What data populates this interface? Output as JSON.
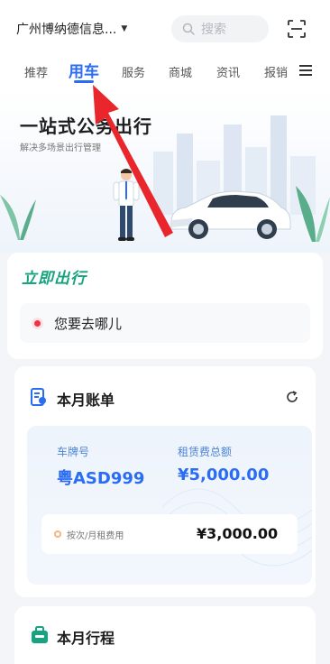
{
  "header": {
    "company_name": "广州博纳德信息...",
    "search_placeholder": "搜索"
  },
  "tabs": [
    {
      "label": "推荐",
      "active": false
    },
    {
      "label": "用车",
      "active": true
    },
    {
      "label": "服务",
      "active": false
    },
    {
      "label": "商城",
      "active": false
    },
    {
      "label": "资讯",
      "active": false
    },
    {
      "label": "报销",
      "active": false
    }
  ],
  "hero": {
    "title": "一站式公务出行",
    "subtitle": "解决多场景出行管理"
  },
  "go": {
    "title": "立即出行",
    "destination_placeholder": "您要去哪儿"
  },
  "bill": {
    "title": "本月账单",
    "plate_label": "车牌号",
    "plate_value": "粤ASD999",
    "total_label": "租赁费总额",
    "total_value": "¥5,000.00",
    "fee_label": "按次/月租费用",
    "fee_value": "¥3,000.00"
  },
  "trip": {
    "title": "本月行程"
  },
  "colors": {
    "accent": "#2a6df4",
    "go_green": "#17a37f",
    "annotation_red": "#e8262b"
  },
  "icons": [
    "chevron-down-icon",
    "search-icon",
    "scan-icon",
    "menu-icon",
    "bill-icon",
    "refresh-icon",
    "trip-icon",
    "annotation-arrow"
  ]
}
